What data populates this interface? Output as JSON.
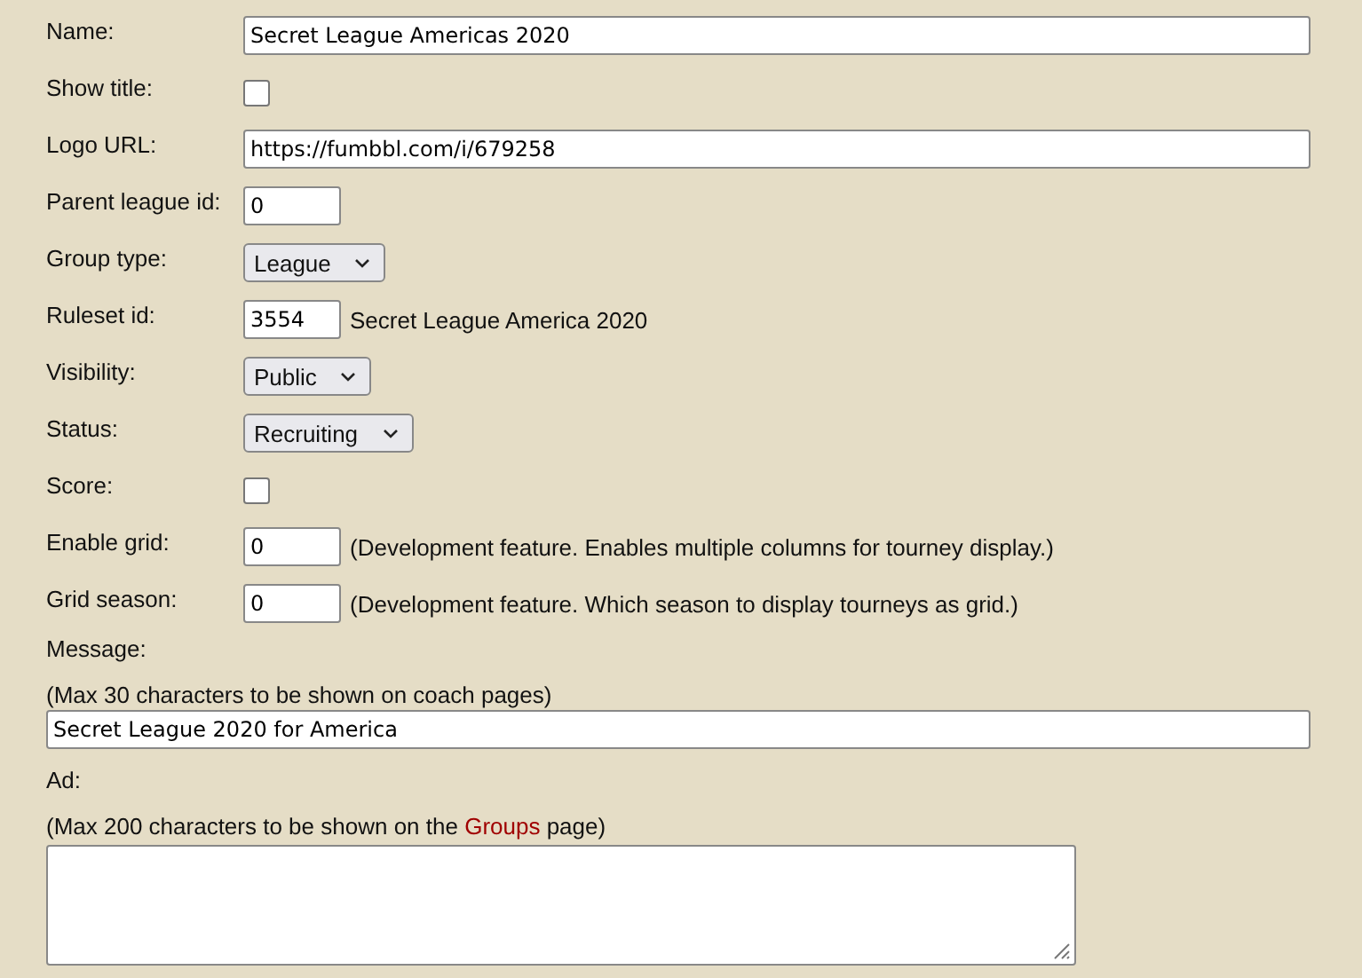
{
  "fields": [
    {
      "label": "Name:",
      "kind": "text",
      "value": "Secret League Americas 2020"
    },
    {
      "label": "Show title:",
      "kind": "checkbox",
      "checked": false
    },
    {
      "label": "Logo URL:",
      "kind": "text",
      "value": "https://fumbbl.com/i/679258"
    },
    {
      "label": "Parent league id:",
      "kind": "short",
      "value": "0"
    },
    {
      "label": "Group type:",
      "kind": "select",
      "value": "League"
    },
    {
      "label": "Ruleset id:",
      "kind": "short",
      "value": "3554",
      "note": "Secret League America 2020"
    },
    {
      "label": "Visibility:",
      "kind": "select",
      "value": "Public"
    },
    {
      "label": "Status:",
      "kind": "select",
      "value": "Recruiting"
    },
    {
      "label": "Score:",
      "kind": "checkbox",
      "checked": false
    },
    {
      "label": "Enable grid:",
      "kind": "short",
      "value": "0",
      "note": "(Development feature. Enables multiple columns for tourney display.)"
    },
    {
      "label": "Grid season:",
      "kind": "short",
      "value": "0",
      "note": "(Development feature. Which season to display tourneys as grid.)"
    }
  ],
  "message": {
    "label": "Message:",
    "hint": "(Max 30 characters to be shown on coach pages)",
    "value": "Secret League 2020 for America"
  },
  "ad": {
    "label": "Ad:",
    "hint_before": "(Max 200 characters to be shown on the ",
    "hint_link": "Groups",
    "hint_after": " page)"
  }
}
